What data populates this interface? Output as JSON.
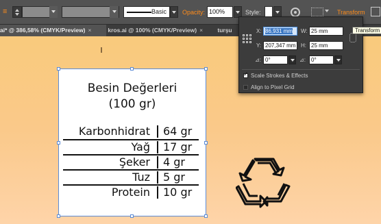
{
  "controlbar": {
    "brush_label": "Basic",
    "opacity_label": "Opacity:",
    "opacity_value": "100%",
    "style_label": "Style:",
    "transform_label": "Transform",
    "colors": {
      "accent": "#ff8c1a",
      "bar_bg": "#535353"
    }
  },
  "tabs": [
    {
      "label": "ai* @ 386,58% (CMYK/Preview)",
      "close": "×"
    },
    {
      "label": "kros.ai @ 100% (CMYK/Preview)",
      "close": "×"
    },
    {
      "label": "turşu"
    }
  ],
  "transform_panel": {
    "x_label": "X:",
    "x_value": "86,931 mm",
    "w_label": "W:",
    "w_value": "25 mm",
    "y_label": "Y:",
    "y_value": "207,347 mm",
    "h_label": "H:",
    "h_value": "25 mm",
    "angle_label": "⊿:",
    "angle_value": "0°",
    "shear_label": "⊿:",
    "shear_value": "0°",
    "scale_strokes_label": "Scale Strokes & Effects",
    "scale_strokes_checked": true,
    "align_pixel_label": "Align to Pixel Grid",
    "align_pixel_checked": false
  },
  "tooltip": "Transform",
  "artwork": {
    "title": "Besin Değerleri",
    "subtitle": "(100 gr)",
    "rows": [
      {
        "name": "Karbonhidrat",
        "value": "64 gr"
      },
      {
        "name": "Yağ",
        "value": "17 gr"
      },
      {
        "name": "Şeker",
        "value": "4 gr"
      },
      {
        "name": "Tuz",
        "value": "5 gr"
      },
      {
        "name": "Protein",
        "value": "10 gr"
      }
    ],
    "icon": "recycle-icon"
  }
}
